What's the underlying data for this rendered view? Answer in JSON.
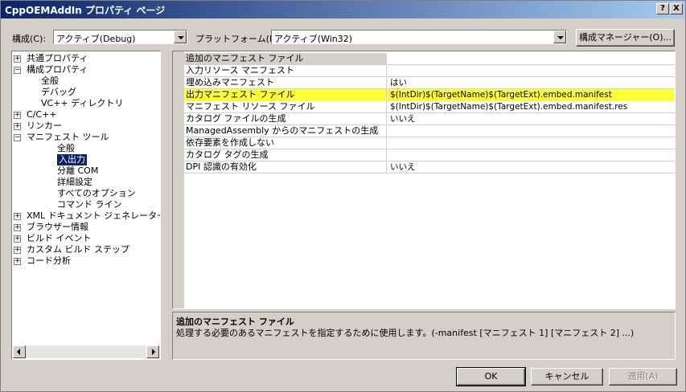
{
  "window": {
    "title": "CppOEMAddIn プロパティ ページ",
    "help_btn": "?",
    "close_btn": "X"
  },
  "config": {
    "config_label": "構成(C):",
    "config_value": "アクティブ(Debug)",
    "platform_label": "プラットフォーム(P):",
    "platform_value": "アクティブ(Win32)",
    "manager_button": "構成マネージャー(O)..."
  },
  "tree": [
    {
      "label": "共通プロパティ",
      "expander": "+"
    },
    {
      "label": "構成プロパティ",
      "expander": "−"
    },
    {
      "label": "全般"
    },
    {
      "label": "デバッグ"
    },
    {
      "label": "VC++ ディレクトリ"
    },
    {
      "label": "C/C++",
      "expander": "+"
    },
    {
      "label": "リンカー",
      "expander": "+"
    },
    {
      "label": "マニフェスト ツール",
      "expander": "−"
    },
    {
      "label": "全般"
    },
    {
      "label": "入出力",
      "selected": true
    },
    {
      "label": "分離 COM"
    },
    {
      "label": "詳細設定"
    },
    {
      "label": "すべてのオプション"
    },
    {
      "label": "コマンド ライン"
    },
    {
      "label": "XML ドキュメント ジェネレーター",
      "expander": "+"
    },
    {
      "label": "ブラウザー情報",
      "expander": "+"
    },
    {
      "label": "ビルド イベント",
      "expander": "+"
    },
    {
      "label": "カスタム ビルド ステップ",
      "expander": "+"
    },
    {
      "label": "コード分析",
      "expander": "+"
    }
  ],
  "properties": [
    {
      "name": "追加のマニフェスト ファイル",
      "value": ""
    },
    {
      "name": "入力リソース マニフェスト",
      "value": ""
    },
    {
      "name": "埋め込みマニフェスト",
      "value": "はい"
    },
    {
      "name": "出力マニフェスト ファイル",
      "value": "$(IntDir)$(TargetName)$(TargetExt).embed.manifest"
    },
    {
      "name": "マニフェスト リソース ファイル",
      "value": "$(IntDir)$(TargetName)$(TargetExt).embed.manifest.res"
    },
    {
      "name": "カタログ ファイルの生成",
      "value": "いいえ"
    },
    {
      "name": "ManagedAssembly からのマニフェストの生成",
      "value": ""
    },
    {
      "name": "依存要素を作成しない",
      "value": ""
    },
    {
      "name": "カタログ タグの生成",
      "value": ""
    },
    {
      "name": "DPI 認識の有効化",
      "value": "いいえ"
    }
  ],
  "description": {
    "title": "追加のマニフェスト ファイル",
    "body": "処理する必要のあるマニフェストを指定するために使用します。(-manifest [マニフェスト 1] [マニフェスト 2] ...)"
  },
  "buttons": {
    "ok": "OK",
    "cancel": "キャンセル",
    "apply": "適用(A)"
  },
  "colors": {
    "highlight_row": "#ffff33",
    "tree_selection": "#0a246a"
  }
}
